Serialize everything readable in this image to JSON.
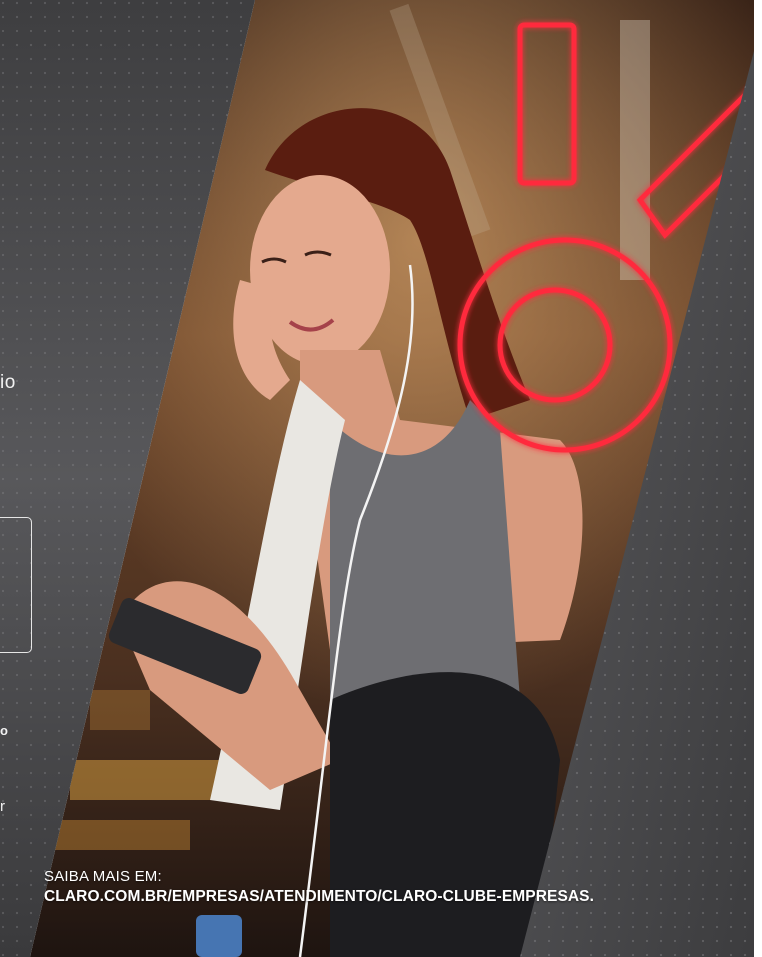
{
  "left_panel": {
    "fragment_io": "io",
    "fragment_o": "o",
    "fragment_r": "r"
  },
  "footer": {
    "lead": "SAIBA MAIS EM:",
    "url": "CLARO.COM.BR/EMPRESAS/ATENDIMENTO/CLARO-CLUBE-EMPRESAS",
    "trailing_dot": "."
  },
  "colors": {
    "panel_gray": "#4b4b4d",
    "neon_red": "#ff2a3c",
    "photo_warm": "#7a4a2a"
  }
}
